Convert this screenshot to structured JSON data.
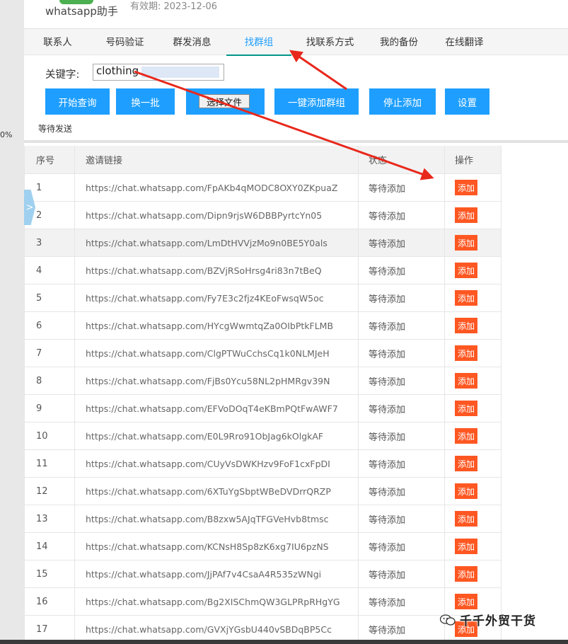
{
  "header": {
    "app_name": "whatsapp助手",
    "validity": "有效期: 2023-12-06"
  },
  "tabs": [
    {
      "label": "联系人"
    },
    {
      "label": "号码验证"
    },
    {
      "label": "群发消息"
    },
    {
      "label": "找群组",
      "active": true
    },
    {
      "label": "找联系方式"
    },
    {
      "label": "我的备份"
    },
    {
      "label": "在线翻译"
    }
  ],
  "search": {
    "label": "关键字:",
    "value": "clothing"
  },
  "buttons": {
    "start": "开始查询",
    "next_batch": "换一批",
    "choose_file": "选择文件",
    "add_all": "一键添加群组",
    "stop": "停止添加",
    "settings": "设置"
  },
  "status": {
    "text": "等待发送",
    "percent": "0%"
  },
  "table": {
    "headers": [
      "序号",
      "邀请链接",
      "状态",
      "操作"
    ],
    "rows": [
      {
        "no": "1",
        "link": "https://chat.whatsapp.com/FpAKb4qMODC8OXY0ZKpuaZ",
        "status": "等待添加",
        "action": "添加"
      },
      {
        "no": "2",
        "link": "https://chat.whatsapp.com/Dipn9rjsW6DBBPyrtcYn05",
        "status": "等待添加",
        "action": "添加"
      },
      {
        "no": "3",
        "link": "https://chat.whatsapp.com/LmDtHVVjzMo9n0BE5Y0als",
        "status": "等待添加",
        "action": "添加"
      },
      {
        "no": "4",
        "link": "https://chat.whatsapp.com/BZVjRSoHrsg4ri83n7tBeQ",
        "status": "等待添加",
        "action": "添加"
      },
      {
        "no": "5",
        "link": "https://chat.whatsapp.com/Fy7E3c2fjz4KEoFwsqW5oc",
        "status": "等待添加",
        "action": "添加"
      },
      {
        "no": "6",
        "link": "https://chat.whatsapp.com/HYcgWwmtqZa0OIbPtkFLMB",
        "status": "等待添加",
        "action": "添加"
      },
      {
        "no": "7",
        "link": "https://chat.whatsapp.com/ClgPTWuCchsCq1k0NLMJeH",
        "status": "等待添加",
        "action": "添加"
      },
      {
        "no": "8",
        "link": "https://chat.whatsapp.com/FjBs0Ycu58NL2pHMRgv39N",
        "status": "等待添加",
        "action": "添加"
      },
      {
        "no": "9",
        "link": "https://chat.whatsapp.com/EFVoDOqT4eKBmPQtFwAWF7",
        "status": "等待添加",
        "action": "添加"
      },
      {
        "no": "10",
        "link": "https://chat.whatsapp.com/E0L9Rro91ObJag6kOlgkAF",
        "status": "等待添加",
        "action": "添加"
      },
      {
        "no": "11",
        "link": "https://chat.whatsapp.com/CUyVsDWKHzv9FoF1cxFpDI",
        "status": "等待添加",
        "action": "添加"
      },
      {
        "no": "12",
        "link": "https://chat.whatsapp.com/6XTuYgSbptWBeDVDrrQRZP",
        "status": "等待添加",
        "action": "添加"
      },
      {
        "no": "13",
        "link": "https://chat.whatsapp.com/B8zxw5AJqTFGVeHvb8tmsc",
        "status": "等待添加",
        "action": "添加"
      },
      {
        "no": "14",
        "link": "https://chat.whatsapp.com/KCNsH8Sp8zK6xg7IU6pzNS",
        "status": "等待添加",
        "action": "添加"
      },
      {
        "no": "15",
        "link": "https://chat.whatsapp.com/JjPAf7v4CsaA4R535zWNgi",
        "status": "等待添加",
        "action": "添加"
      },
      {
        "no": "16",
        "link": "https://chat.whatsapp.com/Bg2XISChmQW3GLPRpRHgYG",
        "status": "等待添加",
        "action": "添加"
      },
      {
        "no": "17",
        "link": "https://chat.whatsapp.com/GVXjYGsbU440vSBDqBP5Cc",
        "status": "等待添加",
        "action": "添加"
      }
    ]
  },
  "watermark": {
    "text": "千千外贸干货"
  },
  "colors": {
    "primary": "#1e9fff",
    "danger": "#ff5722",
    "active_underline": "#009688",
    "annotation_arrow": "#e8281c"
  },
  "icons": {
    "side_toggle": "chevron-right-icon",
    "watermark": "wechat-icon"
  }
}
